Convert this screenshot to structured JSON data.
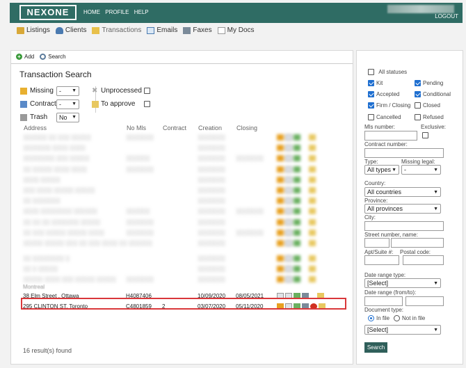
{
  "header": {
    "logo": "NEXONE",
    "nav": [
      "HOME",
      "PROFILE",
      "HELP"
    ],
    "logout": "LOGOUT"
  },
  "mainnav": {
    "items": [
      {
        "label": "Listings",
        "icon": "listings-icon"
      },
      {
        "label": "Clients",
        "icon": "clients-icon"
      },
      {
        "label": "Transactions",
        "icon": "transactions-icon"
      },
      {
        "label": "Emails",
        "icon": "emails-icon"
      },
      {
        "label": "Faxes",
        "icon": "faxes-icon"
      },
      {
        "label": "My Docs",
        "icon": "mydocs-icon"
      }
    ]
  },
  "toolbar": {
    "add": "Add",
    "search": "Search"
  },
  "page_title": "Transaction Search",
  "filters": {
    "missing": {
      "label": "Missing",
      "value": "-"
    },
    "contract": {
      "label": "Contract",
      "value": "-"
    },
    "trash": {
      "label": "Trash",
      "value": "No"
    },
    "unprocessed": {
      "label": "Unprocessed"
    },
    "to_approve": {
      "label": "To approve"
    }
  },
  "table": {
    "headers": [
      "Address",
      "No Mls",
      "Contract",
      "Creation",
      "Closing"
    ],
    "rows": [
      {
        "address": "38 Elm Street , Ottawa",
        "mls": "H4087406",
        "contract": "",
        "creation": "10/09/2020",
        "closing": "08/05/2021"
      },
      {
        "address": "295 CLINTON ST, Toronto",
        "mls": "C4801859",
        "contract": "2",
        "creation": "03/07/2020",
        "closing": "05/11/2020"
      }
    ],
    "blurred_tail": "Montreal"
  },
  "result_count": "16 result(s) found",
  "side": {
    "all_statuses": "All statuses",
    "statuses": [
      {
        "label": "Kit",
        "checked": true
      },
      {
        "label": "Pending",
        "checked": true
      },
      {
        "label": "Accepted",
        "checked": true
      },
      {
        "label": "Conditional",
        "checked": true
      },
      {
        "label": "Firm / Closing",
        "checked": true
      },
      {
        "label": "Closed",
        "checked": false
      },
      {
        "label": "Cancelled",
        "checked": false
      },
      {
        "label": "Refused",
        "checked": false
      }
    ],
    "mls_label": "Mls number:",
    "exclusive_label": "Exclusive:",
    "contract_number_label": "Contract number:",
    "type_label": "Type:",
    "type_value": "All types",
    "missing_legal_label": "Missing legal:",
    "missing_legal_value": "-",
    "country_label": "Country:",
    "country_value": "All countries",
    "province_label": "Province:",
    "province_value": "All provinces",
    "city_label": "City:",
    "street_label": "Street number, name:",
    "apt_label": "Apt/Suite #:",
    "postal_label": "Postal code:",
    "date_range_type_label": "Date range type:",
    "date_range_type_value": "[Select]",
    "date_range_label": "Date range (from/to):",
    "doc_type_label": "Document type:",
    "in_file": "In file",
    "not_in_file": "Not in file",
    "doc_select_value": "[Select]",
    "search_button": "Search"
  }
}
